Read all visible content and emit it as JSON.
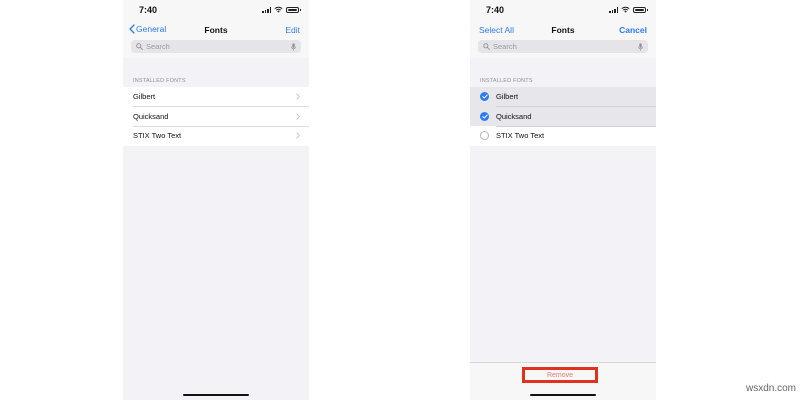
{
  "left_screen": {
    "status_time": "7:40",
    "nav": {
      "back_label": "General",
      "title": "Fonts",
      "right_label": "Edit"
    },
    "search": {
      "placeholder": "Search"
    },
    "section_header": "INSTALLED FONTS",
    "fonts": [
      {
        "name": "Gilbert"
      },
      {
        "name": "Quicksand"
      },
      {
        "name": "STIX Two Text"
      }
    ]
  },
  "right_screen": {
    "status_time": "7:40",
    "nav": {
      "left_label": "Select All",
      "title": "Fonts",
      "right_label": "Cancel"
    },
    "search": {
      "placeholder": "Search"
    },
    "section_header": "INSTALLED FONTS",
    "fonts": [
      {
        "name": "Gilbert",
        "selected": true
      },
      {
        "name": "Quicksand",
        "selected": true
      },
      {
        "name": "STIX Two Text",
        "selected": false
      }
    ],
    "toolbar": {
      "remove_label": "Remove"
    }
  },
  "watermark": "wsxdn.com",
  "colors": {
    "accent": "#2d7cf6",
    "destructive": "#ef7a6c",
    "highlight_box": "#e0301e",
    "background": "#f2f2f7"
  }
}
